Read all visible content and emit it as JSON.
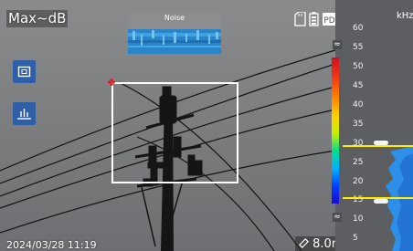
{
  "mode": {
    "label": "Max~dB"
  },
  "noise_panel": {
    "title": "Noise"
  },
  "status": {
    "datetime": "2024/03/28 11:19",
    "distance": "8.0m"
  },
  "spectrum": {
    "unit": "kHz",
    "ticks": [
      "60",
      "55",
      "50",
      "45",
      "40",
      "35",
      "30",
      "25",
      "20",
      "15",
      "10",
      "5"
    ],
    "approx_symbol": "≈",
    "upper_marker_khz": 30,
    "lower_marker_khz": 15
  },
  "icons": {
    "mode": "frame-icon",
    "spectrum": "spectrum-bars-icon",
    "sd": "sd-card-icon",
    "battery": "battery-icon",
    "pd": "pd-icon",
    "distance": "ruler-icon",
    "pole": "power-pole"
  },
  "colors": {
    "accent": "#2f5fa6",
    "marker": "#ffee00",
    "colorbar_top": "#d5101a",
    "colorbar_bottom": "#1a0bd0"
  }
}
